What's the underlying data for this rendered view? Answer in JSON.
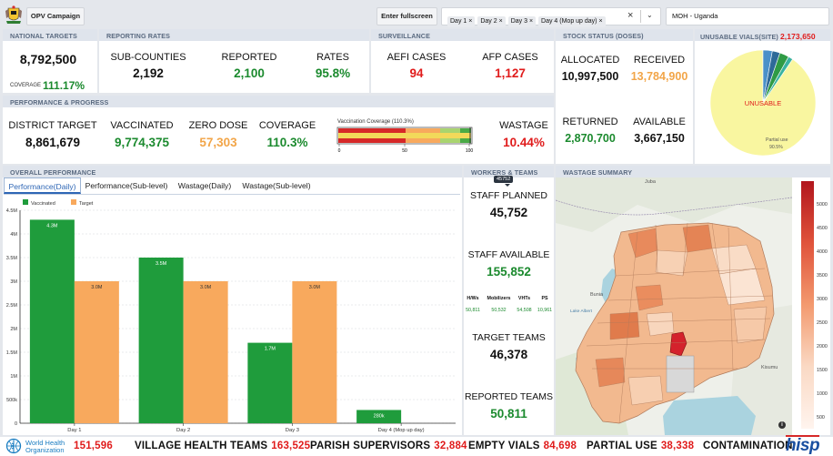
{
  "topbar": {
    "campaign_button": "OPV Campaign",
    "fullscreen_button": "Enter fullscreen",
    "day_chips": [
      "Day 1",
      "Day 2",
      "Day 3",
      "Day 4 (Mop up day)"
    ],
    "org_select": "MOH - Uganda"
  },
  "national_targets": {
    "header": "NATIONAL TARGETS",
    "value": "8,792,500",
    "coverage_label": "COVERAGE",
    "coverage_value": "111.17%"
  },
  "reporting_rates": {
    "header": "REPORTING RATES",
    "sub_counties_label": "SUB-COUNTIES",
    "sub_counties_value": "2,192",
    "reported_label": "REPORTED",
    "reported_value": "2,100",
    "rates_label": "RATES",
    "rates_value": "95.8%"
  },
  "surveillance": {
    "header": "SURVEILLANCE",
    "aefi_label": "AEFI CASES",
    "aefi_value": "94",
    "afp_label": "AFP CASES",
    "afp_value": "1,127"
  },
  "stock": {
    "header": "STOCK STATUS (DOSES)",
    "allocated_label": "ALLOCATED",
    "allocated_value": "10,997,500",
    "received_label": "RECEIVED",
    "received_value": "13,784,900",
    "returned_label": "RETURNED",
    "returned_value": "2,870,700",
    "available_label": "AVAILABLE",
    "available_value": "3,667,150"
  },
  "unusable": {
    "header": "UNUSABLE VIALS(SITE)",
    "count": "2,173,650",
    "pie_label": "UNUSABLE",
    "partial_label": "Partial use",
    "partial_pct": "90.5%",
    "partial_fraction": 0.905,
    "colors": {
      "yellow": "#f9f6a0",
      "blue": "#4a90c8",
      "green": "#2f9b45",
      "darkblue": "#2e6a99",
      "teal": "#3ab3a0"
    }
  },
  "performance": {
    "header": "PERFORMANCE & PROGRESS",
    "district_target_label": "DISTRICT TARGET",
    "district_target_value": "8,861,679",
    "vaccinated_label": "VACCINATED",
    "vaccinated_value": "9,774,375",
    "zero_dose_label": "ZERO DOSE",
    "zero_dose_value": "57,303",
    "coverage_label": "COVERAGE",
    "coverage_value": "110.3%",
    "gauge_title": "Vaccination Coverage (110.3%)",
    "gauge_ticks": [
      "0",
      "50",
      "100"
    ],
    "wastage_label": "WASTAGE",
    "wastage_value": "10.44%"
  },
  "overall": {
    "header": "OVERALL PERFORMANCE",
    "tabs": [
      "Performance(Daily)",
      "Performance(Sub-level)",
      "Wastage(Daily)",
      "Wastage(Sub-level)"
    ]
  },
  "chart_data": {
    "type": "bar",
    "categories": [
      "Day 1",
      "Day 2",
      "Day 3",
      "Day 4 (Mop up day)"
    ],
    "series": [
      {
        "name": "Vaccinated",
        "values": [
          4.3,
          3.5,
          1.7,
          0.28
        ],
        "labels": [
          "4.3M",
          "3.5M",
          "1.7M",
          "280k"
        ],
        "color": "#1f9c3c"
      },
      {
        "name": "Target",
        "values": [
          3.0,
          3.0,
          3.0,
          0
        ],
        "labels": [
          "3.0M",
          "3.0M",
          "3.0M",
          ""
        ],
        "color": "#f8a95d"
      }
    ],
    "yticks": [
      "0",
      "500k",
      "1M",
      "1.5M",
      "2M",
      "2.5M",
      "3M",
      "3.5M",
      "4M",
      "4.5M"
    ],
    "ylim": [
      0,
      4.5
    ],
    "legend": "top-left",
    "grid": true
  },
  "workers": {
    "header": "WORKERS & TEAMS",
    "tooltip": "45752",
    "staff_planned_label": "STAFF PLANNED",
    "staff_planned_value": "45,752",
    "staff_available_label": "STAFF AVAILABLE",
    "staff_available_value": "155,852",
    "cols": [
      {
        "label": "H/Ws",
        "value": "50,811"
      },
      {
        "label": "Mobilizers",
        "value": "50,532"
      },
      {
        "label": "VHTs",
        "value": "54,508"
      },
      {
        "label": "PS",
        "value": "10,961"
      }
    ],
    "target_teams_label": "TARGET TEAMS",
    "target_teams_value": "46,378",
    "reported_teams_label": "REPORTED TEAMS",
    "reported_teams_value": "50,811"
  },
  "wastage_map": {
    "header": "WASTAGE SUMMARY",
    "place_labels": [
      "Juba",
      "Bunia",
      "Lake Albert",
      "Kisumu"
    ],
    "legend_ticks": [
      "5000",
      "4500",
      "4000",
      "3500",
      "3000",
      "2500",
      "2000",
      "1500",
      "1000",
      "500"
    ],
    "info_icon": "i"
  },
  "footer": {
    "who_line1": "World Health",
    "who_line2": "Organization",
    "who_value": "151,596",
    "vht_label": "VILLAGE HEALTH TEAMS",
    "vht_value": "163,525",
    "parish_label": "PARISH SUPERVISORS",
    "parish_value": "32,884",
    "empty_label": "EMPTY VIALS",
    "empty_value": "84,698",
    "partial_label": "PARTIAL USE",
    "partial_value": "38,338",
    "contamination_label": "CONTAMINATION",
    "hisp_logo": "hisp"
  }
}
